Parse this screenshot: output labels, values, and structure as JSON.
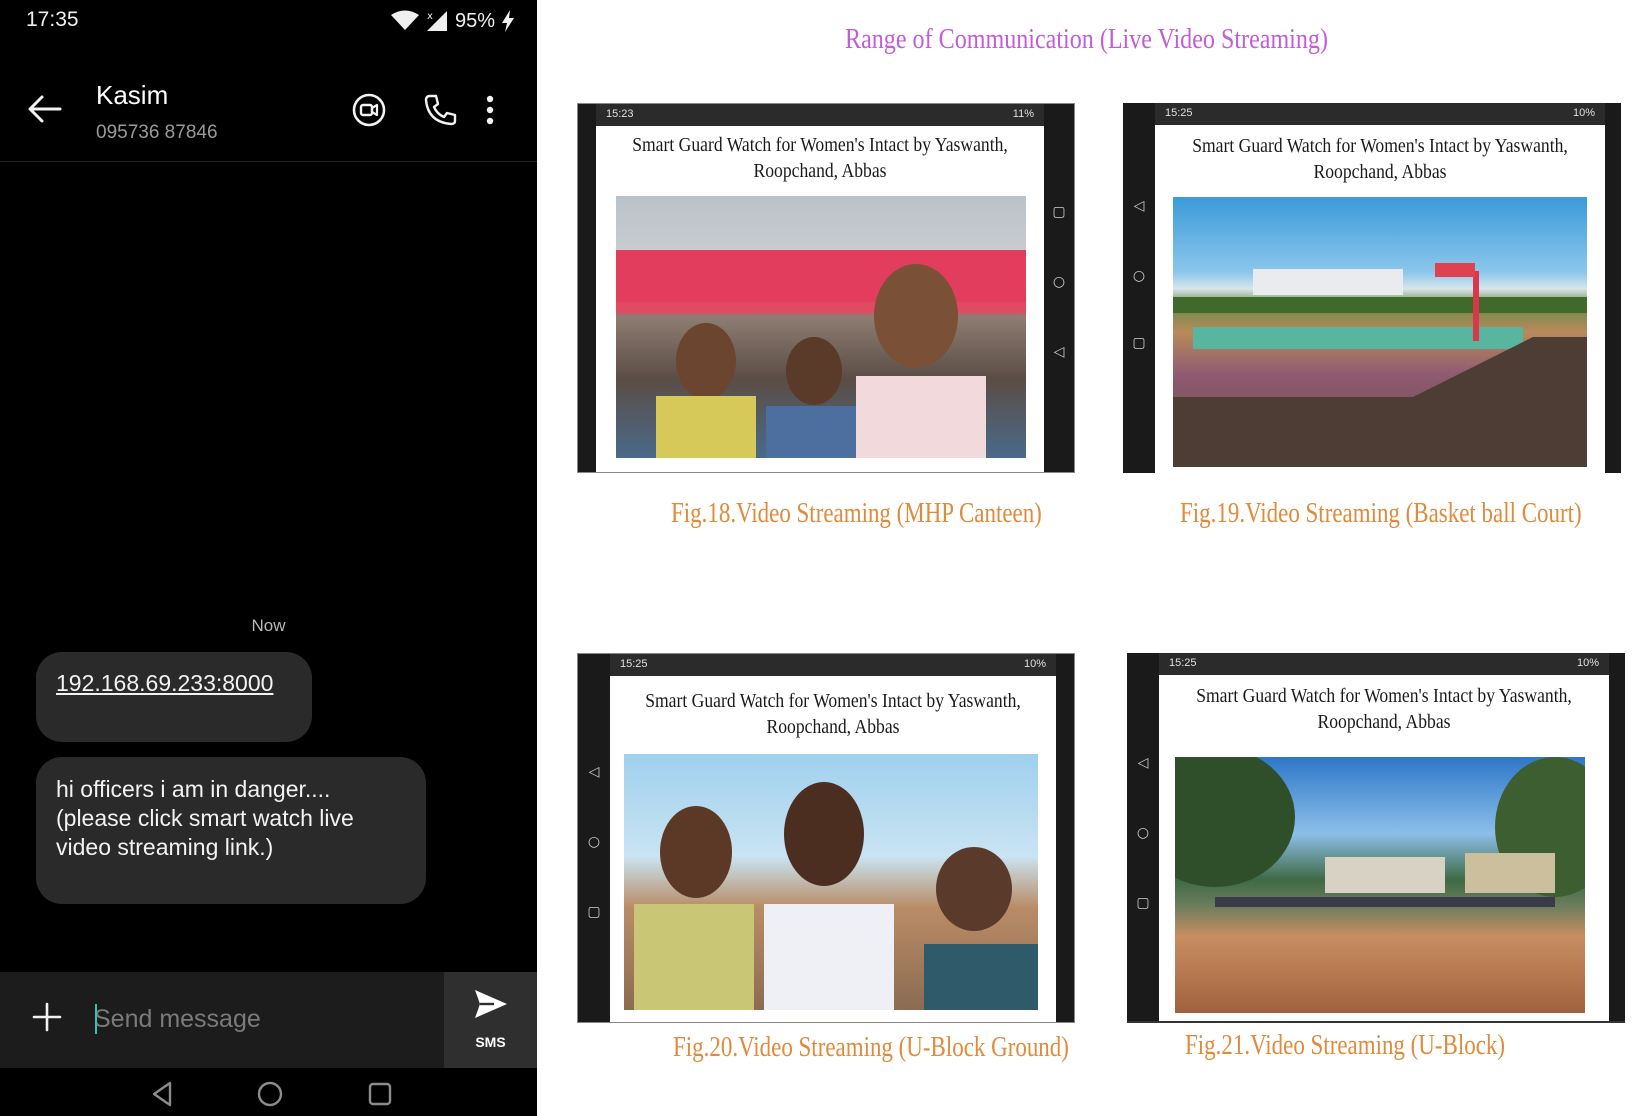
{
  "phone": {
    "status": {
      "time": "17:35",
      "battery": "95%"
    },
    "header": {
      "contact_name": "Kasim",
      "contact_number": "095736 87846"
    },
    "timestamp": "Now",
    "messages": [
      {
        "text": "192.168.69.233:8000",
        "is_link": true
      },
      {
        "lines": [
          "hi officers i am in danger....",
          "(please click smart watch  live",
          "video streaming link.)"
        ]
      }
    ],
    "composer": {
      "placeholder": "Send message",
      "send_label": "SMS"
    },
    "colors": {
      "background": "#000000",
      "bubble": "#2a2a2a",
      "composer": "#1c1c1c",
      "caret": "#2ec4b6"
    }
  },
  "doc": {
    "title": "Range of Communication  (Live Video Streaming)",
    "figures": [
      {
        "status_time": "15:23",
        "status_icons": "11%",
        "heading_line1": "Smart Guard Watch for Women's Intact by Yaswanth,",
        "heading_line2": "Roopchand, Abbas",
        "caption": "Fig.18.Video Streaming (MHP Canteen)"
      },
      {
        "status_time": "15:25",
        "status_icons": "10%",
        "heading_line1": "Smart Guard Watch for Women's Intact by Yaswanth,",
        "heading_line2": "Roopchand, Abbas",
        "caption": "Fig.19.Video Streaming (Basket ball Court)"
      },
      {
        "status_time": "15:25",
        "status_icons": "10%",
        "heading_line1": "Smart Guard Watch for Women's Intact by Yaswanth,",
        "heading_line2": "Roopchand, Abbas",
        "caption": "Fig.20.Video Streaming (U-Block Ground)"
      },
      {
        "status_time": "15:25",
        "status_icons": "10%",
        "heading_line1": "Smart Guard Watch for Women's Intact by Yaswanth,",
        "heading_line2": "Roopchand, Abbas",
        "caption": "Fig.21.Video Streaming (U-Block)"
      }
    ],
    "colors": {
      "title": "#c25cd8",
      "caption": "#e08a3c"
    }
  }
}
